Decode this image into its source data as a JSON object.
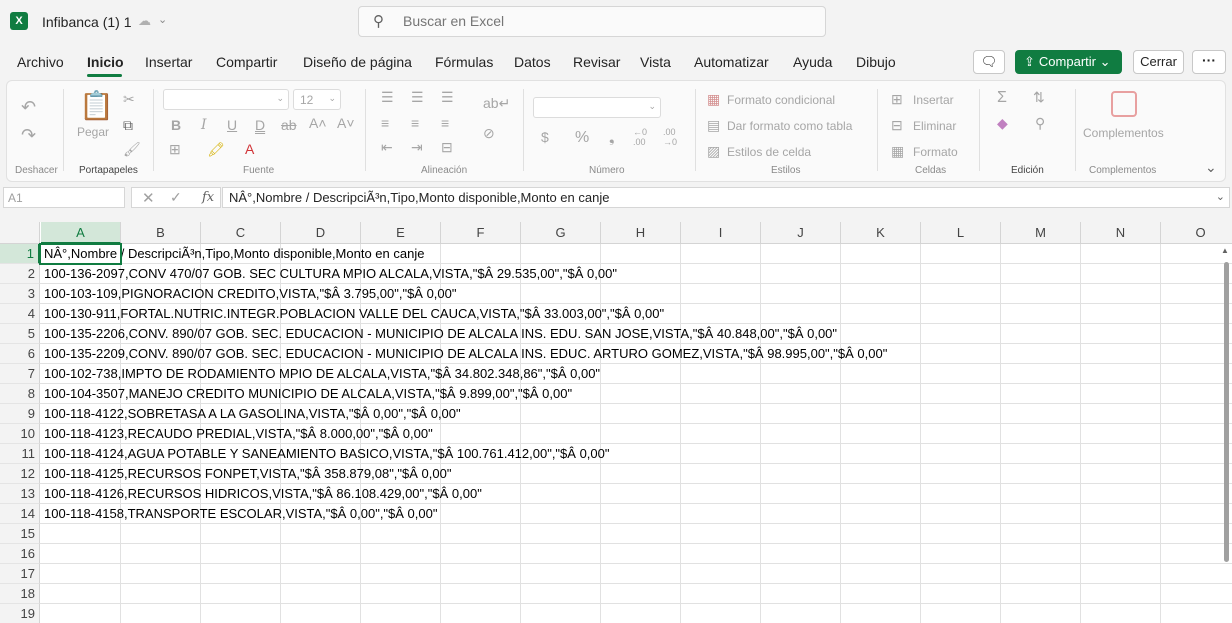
{
  "titlebar": {
    "app_logo": "X",
    "doc_title": "Infibanca (1) 1",
    "search_placeholder": "Buscar en Excel"
  },
  "menu": {
    "tabs": [
      "Archivo",
      "Inicio",
      "Insertar",
      "Compartir",
      "Diseño de página",
      "Fórmulas",
      "Datos",
      "Revisar",
      "Vista",
      "Automatizar",
      "Ayuda",
      "Dibujo"
    ],
    "active_tab": "Inicio",
    "share_label": "Compartir",
    "close_label": "Cerrar",
    "more_label": "···"
  },
  "ribbon": {
    "groups": {
      "undo": "Deshacer",
      "clipboard": "Portapapeles",
      "font": "Fuente",
      "alignment": "Alineación",
      "number": "Número",
      "styles": "Estilos",
      "cells": "Celdas",
      "editing": "Edición",
      "addins": "Complementos"
    },
    "paste_label": "Pegar",
    "font_size": "12",
    "conditional_format": "Formato condicional",
    "format_as_table": "Dar formato como tabla",
    "cell_styles": "Estilos de celda",
    "insert": "Insertar",
    "delete": "Eliminar",
    "format": "Formato",
    "addins_btn": "Complementos"
  },
  "formulabar": {
    "namebox": "A1",
    "formula": "NÂ°,Nombre / DescripciÃ³n,Tipo,Monto disponible,Monto en canje"
  },
  "grid": {
    "columns": [
      "A",
      "B",
      "C",
      "D",
      "E",
      "F",
      "G",
      "H",
      "I",
      "J",
      "K",
      "L",
      "M",
      "N",
      "O"
    ],
    "rows": [
      "1",
      "2",
      "3",
      "4",
      "5",
      "6",
      "7",
      "8",
      "9",
      "10",
      "11",
      "12",
      "13",
      "14",
      "15",
      "16",
      "17",
      "18",
      "19"
    ],
    "cells": [
      "NÂ°,Nombre / DescripciÃ³n,Tipo,Monto disponible,Monto en canje",
      "100-136-2097,CONV 470/07 GOB. SEC CULTURA MPIO ALCALA,VISTA,\"$Â 29.535,00\",\"$Â 0,00\"",
      "100-103-109,PIGNORACION CREDITO,VISTA,\"$Â 3.795,00\",\"$Â 0,00\"",
      "100-130-911,FORTAL.NUTRIC.INTEGR.POBLACION VALLE DEL CAUCA,VISTA,\"$Â 33.003,00\",\"$Â 0,00\"",
      "100-135-2206,CONV. 890/07 GOB. SEC. EDUCACION - MUNICIPIO DE ALCALA INS. EDU. SAN JOSE,VISTA,\"$Â 40.848,00\",\"$Â 0,00\"",
      "100-135-2209,CONV. 890/07 GOB. SEC. EDUCACION - MUNICIPIO DE ALCALA INS. EDUC. ARTURO GOMEZ,VISTA,\"$Â 98.995,00\",\"$Â 0,00\"",
      "100-102-738,IMPTO DE RODAMIENTO MPIO DE ALCALA,VISTA,\"$Â 34.802.348,86\",\"$Â 0,00\"",
      "100-104-3507,MANEJO CREDITO MUNICIPIO DE ALCALA,VISTA,\"$Â 9.899,00\",\"$Â 0,00\"",
      "100-118-4122,SOBRETASA A LA GASOLINA,VISTA,\"$Â 0,00\",\"$Â 0,00\"",
      "100-118-4123,RECAUDO PREDIAL,VISTA,\"$Â 8.000,00\",\"$Â 0,00\"",
      "100-118-4124,AGUA POTABLE Y SANEAMIENTO BASICO,VISTA,\"$Â 100.761.412,00\",\"$Â 0,00\"",
      "100-118-4125,RECURSOS FONPET,VISTA,\"$Â 358.879,08\",\"$Â 0,00\"",
      "100-118-4126,RECURSOS HIDRICOS,VISTA,\"$Â 86.108.429,00\",\"$Â 0,00\"",
      "100-118-4158,TRANSPORTE ESCOLAR,VISTA,\"$Â 0,00\",\"$Â 0,00\""
    ]
  },
  "colors": {
    "accent": "#107c41",
    "selected_header": "#d3e7d9"
  }
}
